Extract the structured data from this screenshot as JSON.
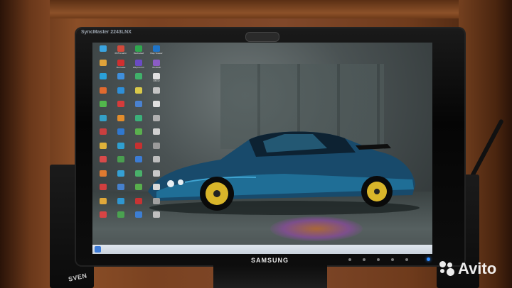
{
  "monitor": {
    "model": "SyncMaster 2243LNX",
    "brand": "SAMSUNG"
  },
  "speaker": {
    "brand": "SVEN"
  },
  "watermark": {
    "text": "Avito"
  },
  "desktop": {
    "icons": [
      {
        "label": "",
        "color": "#3aa4e0"
      },
      {
        "label": "PDFCreator",
        "color": "#d24a3b"
      },
      {
        "label": "MediaGet",
        "color": "#2fa84f"
      },
      {
        "label": "Map Viewer",
        "color": "#1e74c9"
      },
      {
        "label": "",
        "color": "#e0a33a"
      },
      {
        "label": "Фильмы",
        "color": "#d02f2f"
      },
      {
        "label": "WayComm",
        "color": "#6a4bc4"
      },
      {
        "label": "WinRAR",
        "color": "#8b5cc4"
      },
      {
        "label": "",
        "color": "#2aa0d8"
      },
      {
        "label": "",
        "color": "#3f8fdc"
      },
      {
        "label": "",
        "color": "#40b06a"
      },
      {
        "label": "CPU-Z",
        "color": "#e0e0e0"
      },
      {
        "label": "",
        "color": "#e06a2f"
      },
      {
        "label": "",
        "color": "#2e8fd8"
      },
      {
        "label": "",
        "color": "#d9c94a"
      },
      {
        "label": "",
        "color": "#c4c4c4"
      },
      {
        "label": "",
        "color": "#52b84c"
      },
      {
        "label": "",
        "color": "#d63b3b"
      },
      {
        "label": "",
        "color": "#4a82d0"
      },
      {
        "label": "",
        "color": "#e0e0e0"
      },
      {
        "label": "",
        "color": "#34a0c8"
      },
      {
        "label": "",
        "color": "#e28d2c"
      },
      {
        "label": "",
        "color": "#3bb07a"
      },
      {
        "label": "",
        "color": "#b0b0b0"
      },
      {
        "label": "",
        "color": "#c93f3f"
      },
      {
        "label": "",
        "color": "#3078cf"
      },
      {
        "label": "",
        "color": "#5ab04e"
      },
      {
        "label": "",
        "color": "#d0d0d0"
      },
      {
        "label": "",
        "color": "#e0b23a"
      },
      {
        "label": "",
        "color": "#2f9fd0"
      },
      {
        "label": "",
        "color": "#c63030"
      },
      {
        "label": "",
        "color": "#9a9a9a"
      },
      {
        "label": "",
        "color": "#d84a4a"
      },
      {
        "label": "",
        "color": "#4a9e50"
      },
      {
        "label": "",
        "color": "#3c7cd4"
      },
      {
        "label": "",
        "color": "#bdbdbd"
      },
      {
        "label": "",
        "color": "#e07a30"
      },
      {
        "label": "",
        "color": "#35a0d4"
      },
      {
        "label": "",
        "color": "#49b06a"
      },
      {
        "label": "",
        "color": "#c8c8c8"
      },
      {
        "label": "",
        "color": "#d23f3f"
      },
      {
        "label": "",
        "color": "#4680cc"
      },
      {
        "label": "",
        "color": "#58ae4c"
      },
      {
        "label": "",
        "color": "#d9d9d9"
      },
      {
        "label": "",
        "color": "#e0a83a"
      },
      {
        "label": "",
        "color": "#2f96d0"
      },
      {
        "label": "",
        "color": "#c73333"
      },
      {
        "label": "",
        "color": "#a0a0a0"
      },
      {
        "label": "",
        "color": "#d84444"
      },
      {
        "label": "",
        "color": "#4aa250"
      },
      {
        "label": "",
        "color": "#3d7ed2"
      },
      {
        "label": "",
        "color": "#c0c0c0"
      }
    ]
  }
}
